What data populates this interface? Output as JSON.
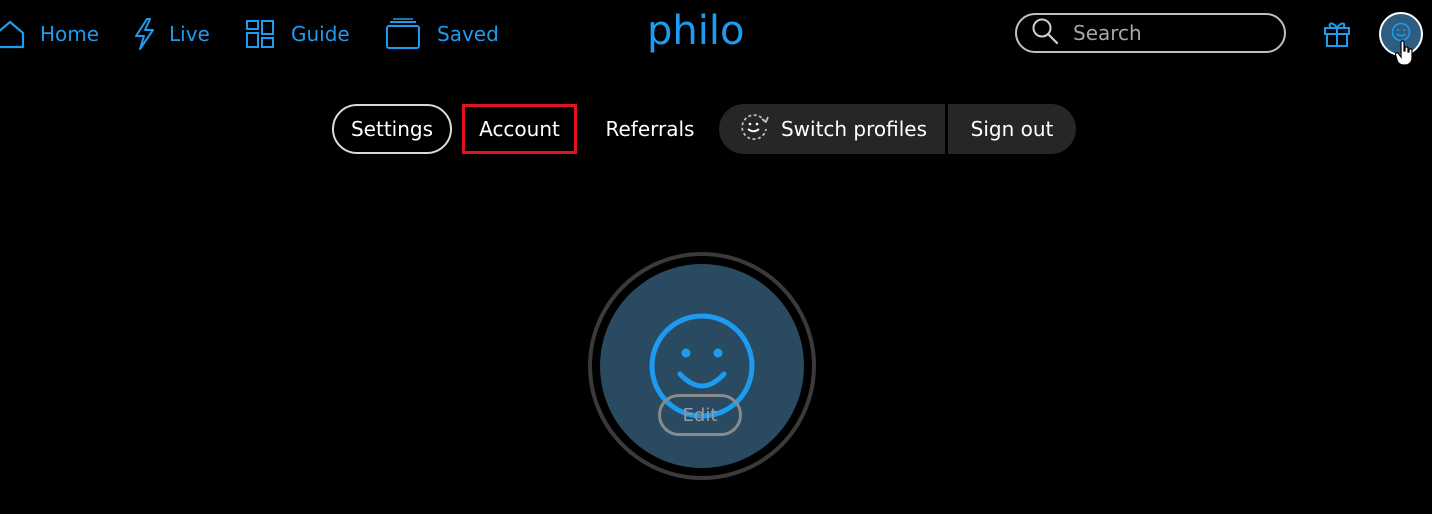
{
  "nav": {
    "home": {
      "label": "Home",
      "icon": "home-icon"
    },
    "live": {
      "label": "Live",
      "icon": "lightning-icon"
    },
    "guide": {
      "label": "Guide",
      "icon": "grid-icon"
    },
    "saved": {
      "label": "Saved",
      "icon": "saved-icon"
    }
  },
  "logo": "philo",
  "search": {
    "placeholder": "Search",
    "icon": "search-icon"
  },
  "header_icons": [
    "gift-icon",
    "profile-smiley-icon"
  ],
  "subnav": {
    "settings": "Settings",
    "account": "Account",
    "referrals": "Referrals",
    "switch_profiles": "Switch profiles",
    "sign_out": "Sign out"
  },
  "profile": {
    "edit_label": "Edit",
    "avatar_icon": "smiley-icon"
  },
  "colors": {
    "accent": "#1d9bf0",
    "background": "#000000",
    "highlight_box": "#e0141e",
    "pill_bg": "#262626",
    "avatar_bg": "#2a4a62"
  }
}
